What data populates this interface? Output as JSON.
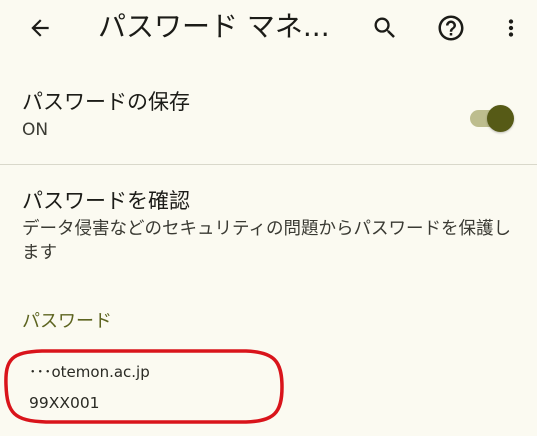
{
  "app_bar": {
    "title": "パスワード マネ...",
    "icons": {
      "back": "arrow-back-icon",
      "search": "search-icon",
      "help": "help-circle-icon",
      "more": "more-vert-icon"
    }
  },
  "save_passwords": {
    "title": "パスワードの保存",
    "status": "ON",
    "enabled": true
  },
  "check_passwords": {
    "title": "パスワードを確認",
    "description": "データ侵害などのセキュリティの問題からパスワードを保護します"
  },
  "passwords_section": {
    "header": "パスワード",
    "items": [
      {
        "site": "･･･otemon.ac.jp",
        "username": "99XX001"
      }
    ]
  },
  "colors": {
    "background": "#fbfaf1",
    "accent": "#565a16",
    "section_header": "#5d6420",
    "highlight": "#d9141b"
  }
}
